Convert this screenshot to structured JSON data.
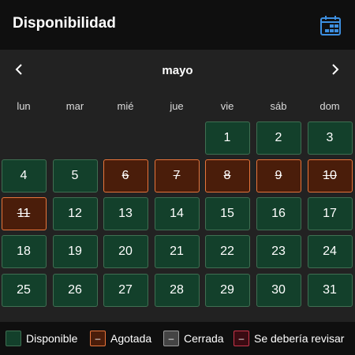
{
  "header": {
    "title": "Disponibilidad",
    "icon": "calendar-icon",
    "icon_color": "#3d8fe0"
  },
  "calendar": {
    "month": "mayo",
    "prev_icon": "chevron-left-icon",
    "next_icon": "chevron-right-icon",
    "weekdays": [
      "lun",
      "mar",
      "mié",
      "jue",
      "vie",
      "sáb",
      "dom"
    ],
    "weeks": [
      [
        null,
        null,
        null,
        null,
        {
          "day": "1",
          "status": "available"
        },
        {
          "day": "2",
          "status": "available"
        },
        {
          "day": "3",
          "status": "available"
        }
      ],
      [
        {
          "day": "4",
          "status": "available"
        },
        {
          "day": "5",
          "status": "available"
        },
        {
          "day": "6",
          "status": "soldout"
        },
        {
          "day": "7",
          "status": "soldout"
        },
        {
          "day": "8",
          "status": "soldout"
        },
        {
          "day": "9",
          "status": "soldout"
        },
        {
          "day": "10",
          "status": "soldout"
        }
      ],
      [
        {
          "day": "11",
          "status": "soldout"
        },
        {
          "day": "12",
          "status": "available"
        },
        {
          "day": "13",
          "status": "available"
        },
        {
          "day": "14",
          "status": "available"
        },
        {
          "day": "15",
          "status": "available"
        },
        {
          "day": "16",
          "status": "available"
        },
        {
          "day": "17",
          "status": "available"
        }
      ],
      [
        {
          "day": "18",
          "status": "available"
        },
        {
          "day": "19",
          "status": "available"
        },
        {
          "day": "20",
          "status": "available"
        },
        {
          "day": "21",
          "status": "available"
        },
        {
          "day": "22",
          "status": "available"
        },
        {
          "day": "23",
          "status": "available"
        },
        {
          "day": "24",
          "status": "available"
        }
      ],
      [
        {
          "day": "25",
          "status": "available"
        },
        {
          "day": "26",
          "status": "available"
        },
        {
          "day": "27",
          "status": "available"
        },
        {
          "day": "28",
          "status": "available"
        },
        {
          "day": "29",
          "status": "available"
        },
        {
          "day": "30",
          "status": "available"
        },
        {
          "day": "31",
          "status": "available"
        }
      ]
    ]
  },
  "legend": [
    {
      "label": "Disponible",
      "symbol": "",
      "fill": "#13402b",
      "border": "#3f6f52"
    },
    {
      "label": "Agotada",
      "symbol": "–",
      "fill": "#4a1d0a",
      "border": "#e8743a"
    },
    {
      "label": "Cerrada",
      "symbol": "–",
      "fill": "#444444",
      "border": "#9a9a9a"
    },
    {
      "label": "Se debería revisar",
      "symbol": "–",
      "fill": "#3a0b12",
      "border": "#c8354a"
    }
  ]
}
